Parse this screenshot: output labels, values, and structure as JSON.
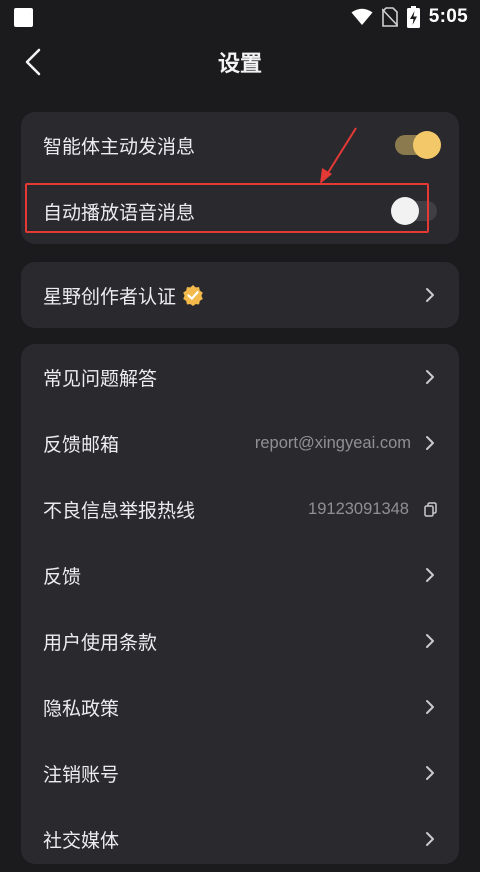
{
  "status_bar": {
    "time": "5:05",
    "icons": [
      "app-square-icon",
      "wifi-icon",
      "no-sim-icon",
      "battery-charging-icon"
    ]
  },
  "header": {
    "title": "设置",
    "back_icon": "chevron-left-icon"
  },
  "sections": {
    "toggles": {
      "agent_messages": {
        "label": "智能体主动发消息",
        "enabled": true
      },
      "auto_voice": {
        "label": "自动播放语音消息",
        "enabled": false
      }
    },
    "creator": {
      "label": "星野创作者认证",
      "badge_icon": "verified-badge-icon"
    },
    "list": {
      "faq": {
        "label": "常见问题解答"
      },
      "feedback_email": {
        "label": "反馈邮箱",
        "value": "report@xingyeai.com"
      },
      "report_hotline": {
        "label": "不良信息举报热线",
        "value": "19123091348"
      },
      "feedback": {
        "label": "反馈"
      },
      "terms": {
        "label": "用户使用条款"
      },
      "privacy": {
        "label": "隐私政策"
      },
      "delete_account": {
        "label": "注销账号"
      },
      "social_media": {
        "label": "社交媒体"
      }
    }
  },
  "colors": {
    "background": "#1b1b1d",
    "card": "#2a2a2e",
    "toggle_on_knob": "#f3c869",
    "toggle_on_track": "#8a7a4e",
    "annotation": "#e53935"
  }
}
